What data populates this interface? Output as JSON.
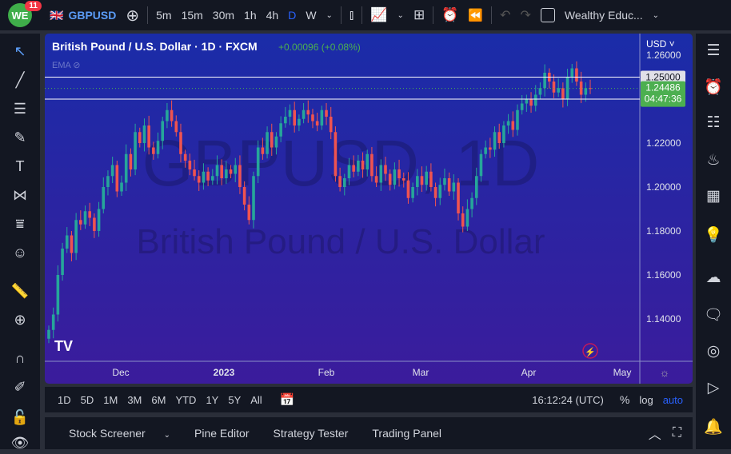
{
  "topbar": {
    "badge": "11",
    "logo": "WE",
    "symbol": "GBPUSD",
    "intervals": [
      "5m",
      "15m",
      "30m",
      "1h",
      "4h",
      "D",
      "W"
    ],
    "active_interval": "D",
    "layout_name": "Wealthy Educ..."
  },
  "legend": {
    "title": "British Pound / U.S. Dollar · 1D · FXCM",
    "change": "+0.00096 (+0.08%)",
    "indicator": "EMA"
  },
  "watermark": {
    "symbol": "GBPUSD, 1D",
    "name": "British Pound / U.S. Dollar"
  },
  "price_axis": {
    "currency": "USD",
    "ticks": [
      "1.26000",
      "1.22000",
      "1.20000",
      "1.18000",
      "1.16000",
      "1.14000"
    ],
    "line_high": "1.25000",
    "line_low": "1.24000",
    "last_price": "1.24486",
    "countdown": "04:47:36"
  },
  "time_axis": [
    "Dec",
    "2023",
    "Feb",
    "Mar",
    "Apr",
    "May"
  ],
  "colors": {
    "up": "#26a69a",
    "down": "#ef5350",
    "last": "#4caf50",
    "bg_top": "#1a2ca8",
    "bg_bottom": "#3b1c9c"
  },
  "chart_data": {
    "type": "candlestick",
    "ylim": [
      1.13,
      1.265
    ],
    "closes": [
      1.135,
      1.142,
      1.16,
      1.172,
      1.178,
      1.17,
      1.185,
      1.183,
      1.189,
      1.186,
      1.18,
      1.19,
      1.2,
      1.205,
      1.21,
      1.198,
      1.202,
      1.215,
      1.208,
      1.225,
      1.22,
      1.228,
      1.218,
      1.215,
      1.221,
      1.23,
      1.235,
      1.23,
      1.225,
      1.215,
      1.212,
      1.208,
      1.205,
      1.202,
      1.207,
      1.203,
      1.205,
      1.21,
      1.204,
      1.208,
      1.206,
      1.21,
      1.2,
      1.192,
      1.185,
      1.205,
      1.218,
      1.215,
      1.225,
      1.218,
      1.223,
      1.229,
      1.232,
      1.235,
      1.228,
      1.231,
      1.235,
      1.233,
      1.23,
      1.228,
      1.235,
      1.232,
      1.225,
      1.205,
      1.2,
      1.204,
      1.21,
      1.207,
      1.212,
      1.208,
      1.215,
      1.205,
      1.202,
      1.21,
      1.206,
      1.201,
      1.208,
      1.204,
      1.203,
      1.195,
      1.2,
      1.205,
      1.201,
      1.207,
      1.2,
      1.195,
      1.201,
      1.204,
      1.198,
      1.202,
      1.188,
      1.182,
      1.19,
      1.195,
      1.205,
      1.215,
      1.218,
      1.217,
      1.225,
      1.22,
      1.228,
      1.23,
      1.226,
      1.235,
      1.238,
      1.24,
      1.237,
      1.242,
      1.245,
      1.252,
      1.248,
      1.243,
      1.245,
      1.24,
      1.25,
      1.254,
      1.248,
      1.242,
      1.245,
      1.24486
    ]
  },
  "bottombar": {
    "ranges": [
      "1D",
      "5D",
      "1M",
      "3M",
      "6M",
      "YTD",
      "1Y",
      "5Y",
      "All"
    ],
    "clock": "16:12:24 (UTC)",
    "percent": "%",
    "log": "log",
    "auto": "auto"
  },
  "panel": {
    "tabs": [
      "Stock Screener",
      "Pine Editor",
      "Strategy Tester",
      "Trading Panel"
    ]
  }
}
